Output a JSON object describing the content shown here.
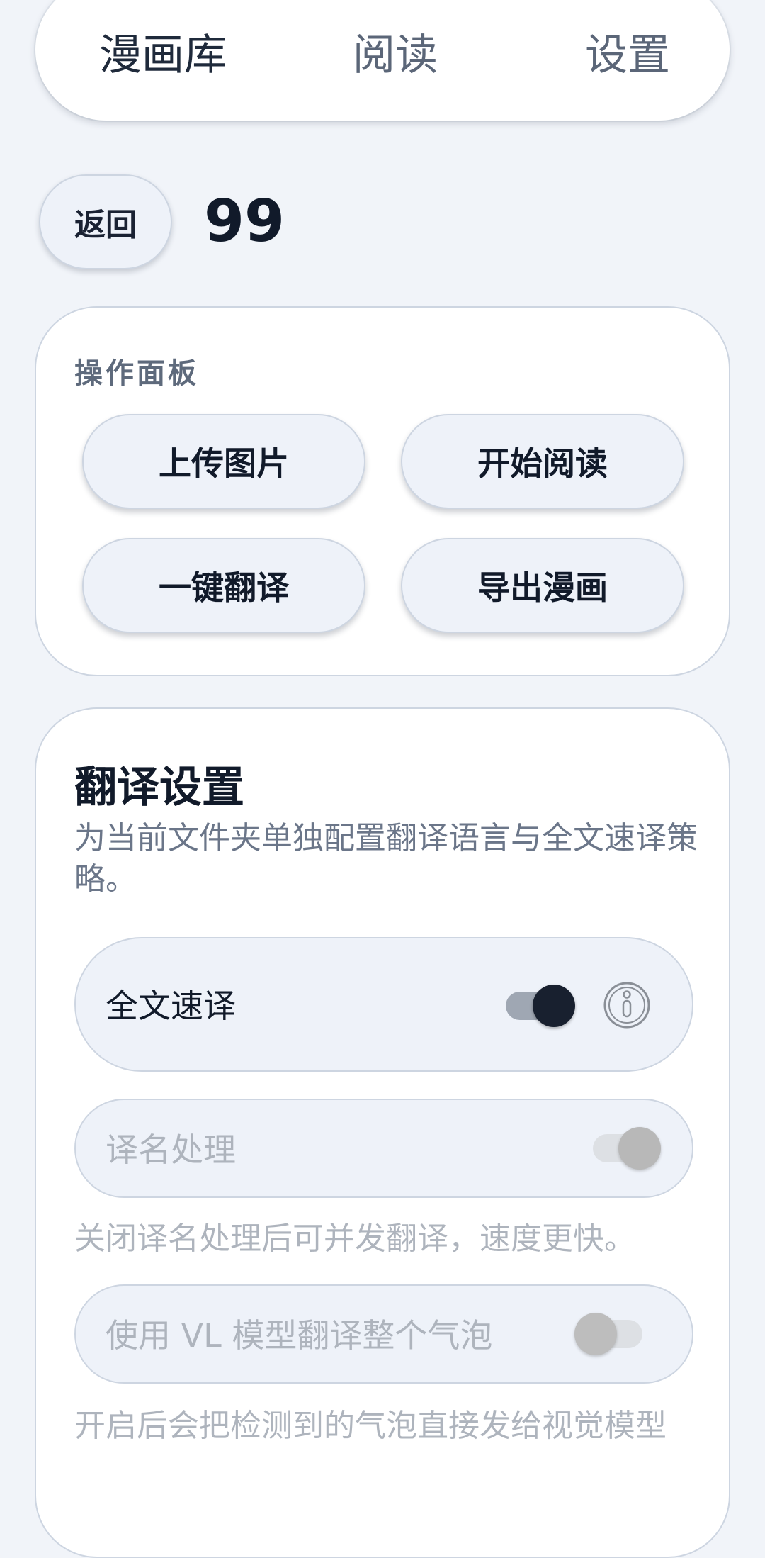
{
  "tabs": {
    "library": "漫画库",
    "reader": "阅读",
    "settings": "设置"
  },
  "header": {
    "back_label": "返回",
    "folder_name": "99"
  },
  "panel": {
    "title": "操作面板",
    "upload_label": "上传图片",
    "read_label": "开始阅读",
    "translate_label": "一键翻译",
    "export_label": "导出漫画"
  },
  "translation_settings": {
    "title": "翻译设置",
    "description": "为当前文件夹单独配置翻译语言与全文速译策略。",
    "fast_translate": {
      "label": "全文速译",
      "enabled": true
    },
    "name_handling": {
      "label": "译名处理",
      "enabled": true,
      "disabled": true,
      "hint": "关闭译名处理后可并发翻译，速度更快。"
    },
    "vl_bubble": {
      "label": "使用 VL 模型翻译整个气泡",
      "enabled": false,
      "disabled": true,
      "hint": "开启后会把检测到的气泡直接发给视觉模型"
    }
  },
  "icons": {
    "info": "info-icon"
  },
  "colors": {
    "background": "#f1f4f9",
    "card": "#ffffff",
    "row": "#eef2f9",
    "border": "#cdd5e1",
    "primary_text": "#111a2a",
    "muted_text": "#6b7689",
    "disabled_text": "#aeb4bd",
    "switch_on": "#18202f"
  }
}
